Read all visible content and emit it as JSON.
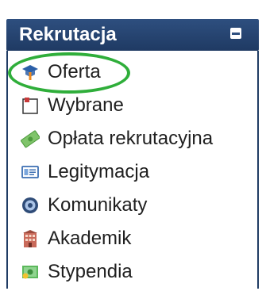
{
  "panel": {
    "title": "Rekrutacja",
    "collapse_icon": "minus-square-icon"
  },
  "menu": {
    "items": [
      {
        "label": "Oferta",
        "icon": "graduation-cap-icon"
      },
      {
        "label": "Wybrane",
        "icon": "notepad-icon"
      },
      {
        "label": "Opłata rekrutacyjna",
        "icon": "money-icon"
      },
      {
        "label": "Legitymacja",
        "icon": "id-card-icon"
      },
      {
        "label": "Komunikaty",
        "icon": "message-icon"
      },
      {
        "label": "Akademik",
        "icon": "building-icon"
      },
      {
        "label": "Stypendia",
        "icon": "banknote-icon"
      }
    ]
  },
  "colors": {
    "header_bg": "#2e4f7f",
    "highlight": "#2fae3a"
  }
}
